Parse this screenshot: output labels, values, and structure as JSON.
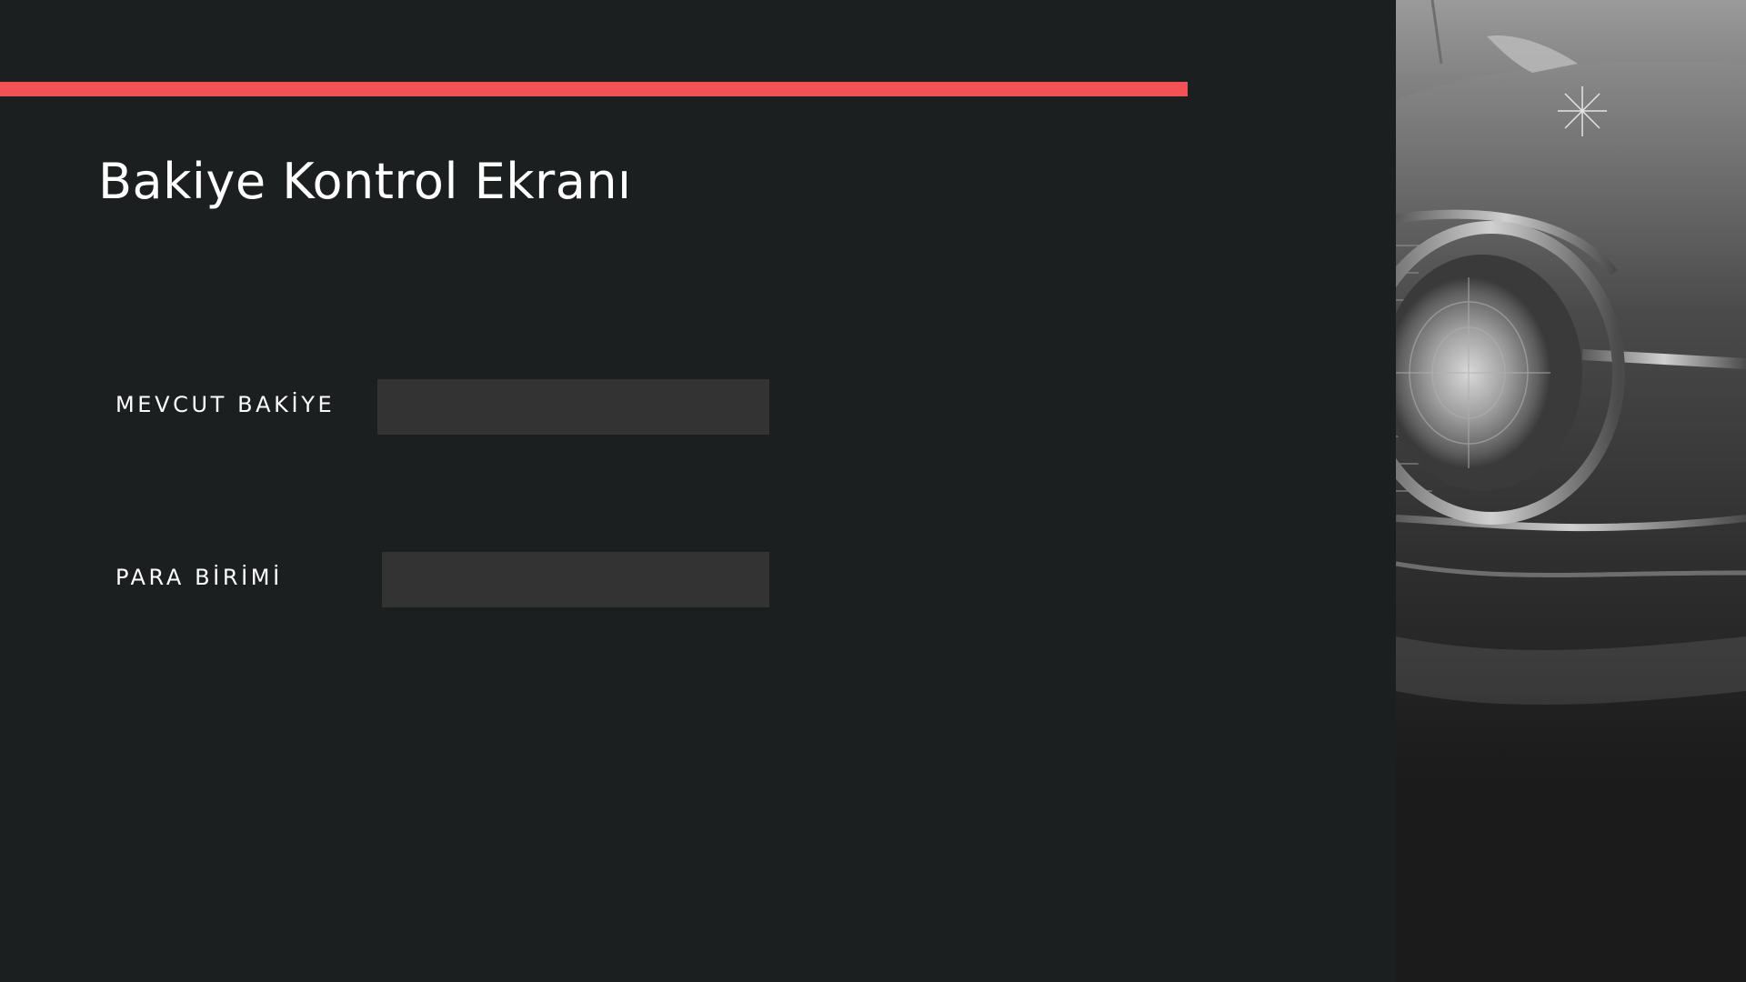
{
  "screen": {
    "title": "Bakiye Kontrol Ekranı"
  },
  "fields": {
    "balance": {
      "label": "MEVCUT BAKİYE",
      "value": ""
    },
    "currency": {
      "label": "PARA BİRİMİ",
      "value": ""
    }
  },
  "colors": {
    "background": "#1c1f1f",
    "accent": "#f45154",
    "field_background": "#333333",
    "text": "#ffffff"
  },
  "image": {
    "subject": "classic-car-headlight-photo"
  }
}
